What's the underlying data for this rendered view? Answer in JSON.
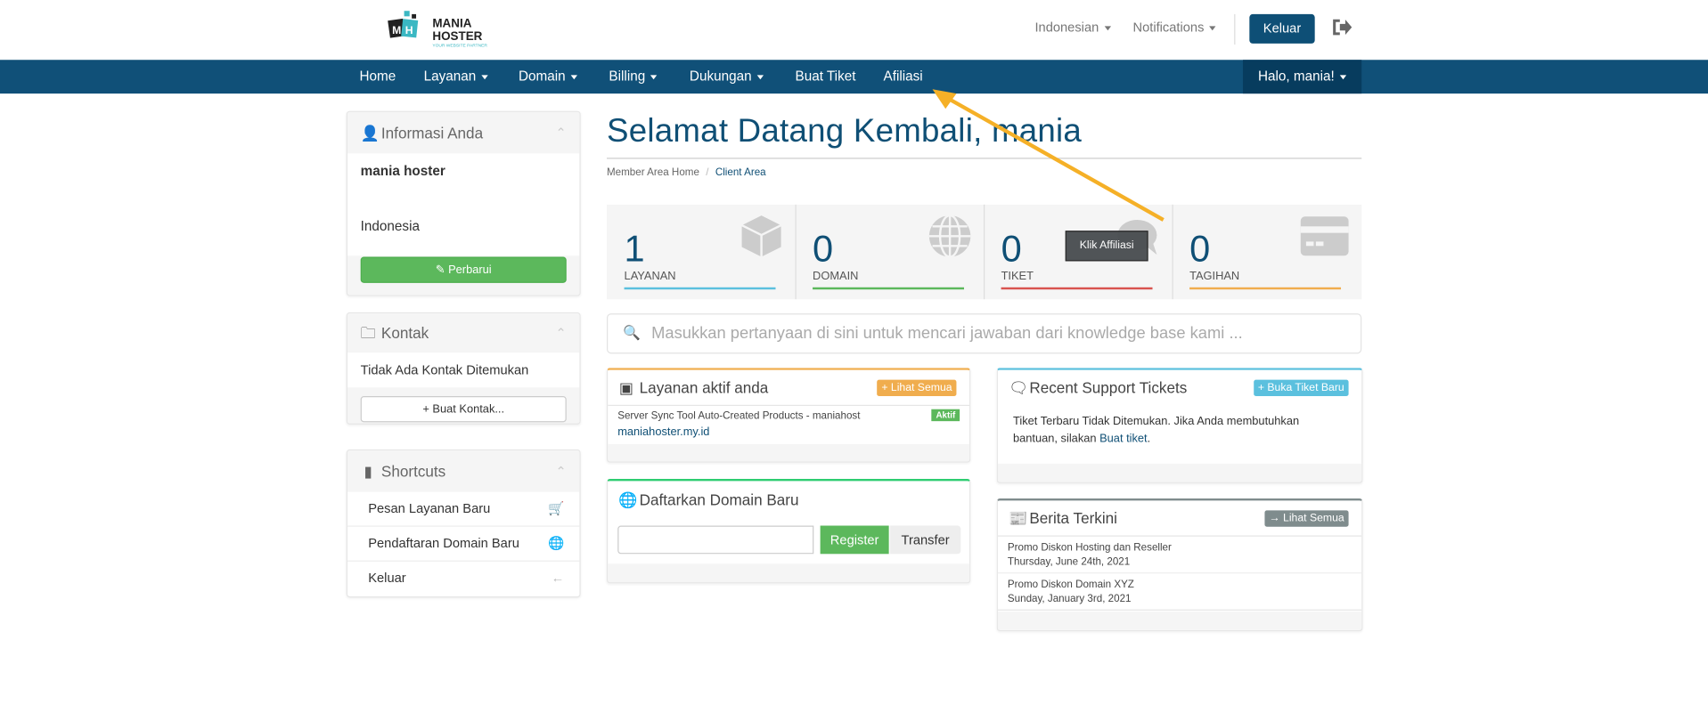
{
  "brand": {
    "logo_text_1": "MANIA",
    "logo_text_2": "HOSTER",
    "logo_tagline": "YOUR WEBSITE PARTNER"
  },
  "topbar": {
    "language": "Indonesian",
    "notifications": "Notifications",
    "logout_button": "Keluar"
  },
  "nav": {
    "items": [
      "Home",
      "Layanan",
      "Domain",
      "Billing",
      "Dukungan",
      "Buat Tiket",
      "Afiliasi"
    ],
    "user_menu": "Halo, mania!"
  },
  "sidebar": {
    "info": {
      "title": "Informasi Anda",
      "name": "mania hoster",
      "country": "Indonesia",
      "update_button": "Perbarui"
    },
    "contacts": {
      "title": "Kontak",
      "empty": "Tidak Ada Kontak Ditemukan",
      "add_button": "Buat Kontak..."
    },
    "shortcuts": {
      "title": "Shortcuts",
      "items": [
        "Pesan Layanan Baru",
        "Pendaftaran Domain Baru",
        "Keluar"
      ]
    }
  },
  "main": {
    "title": "Selamat Datang Kembali, mania",
    "breadcrumb": [
      "Member Area Home",
      "Client Area"
    ],
    "stats": [
      {
        "value": "1",
        "label": "LAYANAN",
        "color": "#5bc0de"
      },
      {
        "value": "0",
        "label": "DOMAIN",
        "color": "#5cb85c"
      },
      {
        "value": "0",
        "label": "TIKET",
        "color": "#d9534f"
      },
      {
        "value": "0",
        "label": "TAGIHAN",
        "color": "#f0ad4e"
      }
    ],
    "search_placeholder": "Masukkan pertanyaan di sini untuk mencari jawaban dari knowledge base kami ...",
    "services": {
      "title": "Layanan aktif anda",
      "button": "Lihat Semua",
      "product": "Server Sync Tool Auto-Created Products - maniahost",
      "domain": "maniahoster.my.id",
      "status": "Aktif"
    },
    "register_domain": {
      "title": "Daftarkan Domain Baru",
      "register_button": "Register",
      "transfer_button": "Transfer",
      "input_value": ""
    },
    "tickets": {
      "title": "Recent Support Tickets",
      "button": "Buka Tiket Baru",
      "text": "Tiket Terbaru Tidak Ditemukan. Jika Anda membutuhkan bantuan, silakan ",
      "link": "Buat tiket",
      "end": "."
    },
    "news": {
      "title": "Berita Terkini",
      "button": "Lihat Semua",
      "items": [
        {
          "title": "Promo Diskon Hosting dan Reseller",
          "date": "Thursday, June 24th, 2021"
        },
        {
          "title": "Promo Diskon Domain XYZ",
          "date": "Sunday, January 3rd, 2021"
        }
      ]
    }
  },
  "annotation": {
    "tooltip": "Klik Affiliasi",
    "arrow_color": "#f5b027"
  }
}
